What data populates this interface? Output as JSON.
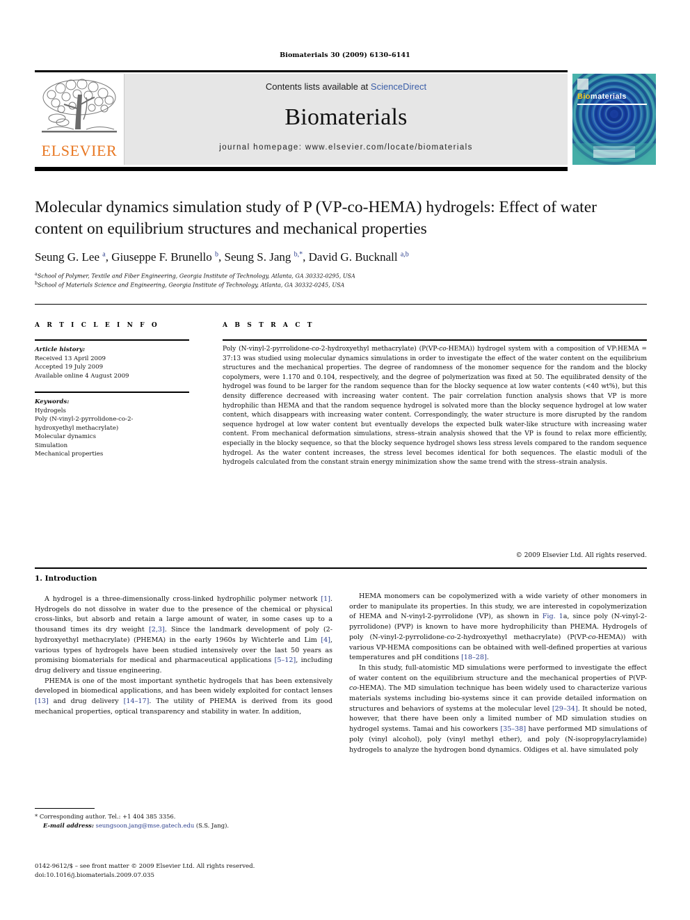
{
  "running_head": "Biomaterials 30 (2009) 6130–6141",
  "header": {
    "publisher_logo_text": "ELSEVIER",
    "contents_prefix": "Contents lists available at ",
    "contents_link": "ScienceDirect",
    "journal_name": "Biomaterials",
    "homepage": "journal homepage: www.elsevier.com/locate/biomaterials",
    "cover": {
      "title_part1": "Bio",
      "title_part2": "materials"
    },
    "link_color": "#3b5ea8",
    "band_color": "#e6e6e6",
    "elsevier_orange": "#E87722",
    "cover_teal": "#2e9b9b"
  },
  "article": {
    "title": "Molecular dynamics simulation study of P (VP-co-HEMA) hydrogels: Effect of water content on equilibrium structures and mechanical properties",
    "authors_html": "Seung G. Lee <sup>a</sup>, Giuseppe F. Brunello <sup>b</sup>, Seung S. Jang <sup>b,*</sup>, David G. Bucknall <sup>a,b</sup>",
    "affiliations": [
      {
        "marker": "a",
        "text": "School of Polymer, Textile and Fiber Engineering, Georgia Institute of Technology, Atlanta, GA 30332-0295, USA"
      },
      {
        "marker": "b",
        "text": "School of Materials Science and Engineering, Georgia Institute of Technology, Atlanta, GA 30332-0245, USA"
      }
    ]
  },
  "article_info": {
    "heading": "A R T I C L E   I N F O",
    "history_label": "Article history:",
    "history": [
      "Received 13 April 2009",
      "Accepted 19 July 2009",
      "Available online 4 August 2009"
    ],
    "keywords_label": "Keywords:",
    "keywords": [
      "Hydrogels",
      "Poly (N-vinyl-2-pyrrolidone-co-2-",
      "hydroxyethyl methacrylate)",
      "Molecular dynamics",
      "Simulation",
      "Mechanical properties"
    ]
  },
  "abstract": {
    "heading": "A B S T R A C T",
    "text": "Poly (N-vinyl-2-pyrrolidone-co-2-hydroxyethyl methacrylate) (P(VP-co-HEMA)) hydrogel system with a composition of VP:HEMA = 37:13 was studied using molecular dynamics simulations in order to investigate the effect of the water content on the equilibrium structures and the mechanical properties. The degree of randomness of the monomer sequence for the random and the blocky copolymers, were 1.170 and 0.104, respectively, and the degree of polymerization was fixed at 50. The equilibrated density of the hydrogel was found to be larger for the random sequence than for the blocky sequence at low water contents (<40 wt%), but this density difference decreased with increasing water content. The pair correlation function analysis shows that VP is more hydrophilic than HEMA and that the random sequence hydrogel is solvated more than the blocky sequence hydrogel at low water content, which disappears with increasing water content. Correspondingly, the water structure is more disrupted by the random sequence hydrogel at low water content but eventually develops the expected bulk water-like structure with increasing water content. From mechanical deformation simulations, stress–strain analysis showed that the VP is found to relax more efficiently, especially in the blocky sequence, so that the blocky sequence hydrogel shows less stress levels compared to the random sequence hydrogel. As the water content increases, the stress level becomes identical for both sequences. The elastic moduli of the hydrogels calculated from the constant strain energy minimization show the same trend with the stress–strain analysis.",
    "copyright": "© 2009 Elsevier Ltd. All rights reserved."
  },
  "body": {
    "section_heading": "1. Introduction",
    "left_paragraphs": [
      "A hydrogel is a three-dimensionally cross-linked hydrophilic polymer network [1]. Hydrogels do not dissolve in water due to the presence of the chemical or physical cross-links, but absorb and retain a large amount of water, in some cases up to a thousand times its dry weight [2,3]. Since the landmark development of poly (2-hydroxyethyl methacrylate) (PHEMA) in the early 1960s by Wichterle and Lim [4], various types of hydrogels have been studied intensively over the last 50 years as promising biomaterials for medical and pharmaceutical applications [5–12], including drug delivery and tissue engineering.",
      "PHEMA is one of the most important synthetic hydrogels that has been extensively developed in biomedical applications, and has been widely exploited for contact lenses [13] and drug delivery [14–17]. The utility of PHEMA is derived from its good mechanical properties, optical transparency and stability in water. In addition,"
    ],
    "right_paragraphs": [
      "HEMA monomers can be copolymerized with a wide variety of other monomers in order to manipulate its properties. In this study, we are interested in copolymerization of HEMA and N-vinyl-2-pyrrolidone (VP), as shown in Fig. 1a, since poly (N-vinyl-2-pyrrolidone) (PVP) is known to have more hydrophilicity than PHEMA. Hydrogels of poly (N-vinyl-2-pyrrolidone-co-2-hydroxyethyl methacrylate) (P(VP-co-HEMA)) with various VP-HEMA compositions can be obtained with well-defined properties at various temperatures and pH conditions [18–28].",
      "In this study, full-atomistic MD simulations were performed to investigate the effect of water content on the equilibrium structure and the mechanical properties of P(VP-co-HEMA). The MD simulation technique has been widely used to characterize various materials systems including bio-systems since it can provide detailed information on structures and behaviors of systems at the molecular level [29–34]. It should be noted, however, that there have been only a limited number of MD simulation studies on hydrogel systems. Tamai and his coworkers [35–38] have performed MD simulations of poly (vinyl alcohol), poly (vinyl methyl ether), and poly (N-isopropylacrylamide) hydrogels to analyze the hydrogen bond dynamics. Oldiges et al. have simulated poly"
    ],
    "reference_color": "#2b3e8c"
  },
  "footer": {
    "corresponding": "* Corresponding author. Tel.: +1 404 385 3356.",
    "email_label": "E-mail address:",
    "email": "seungsoon.jang@mse.gatech.edu",
    "email_suffix": " (S.S. Jang).",
    "issn_line": "0142-9612/$ – see front matter © 2009 Elsevier Ltd. All rights reserved.",
    "doi_line": "doi:10.1016/j.biomaterials.2009.07.035"
  }
}
